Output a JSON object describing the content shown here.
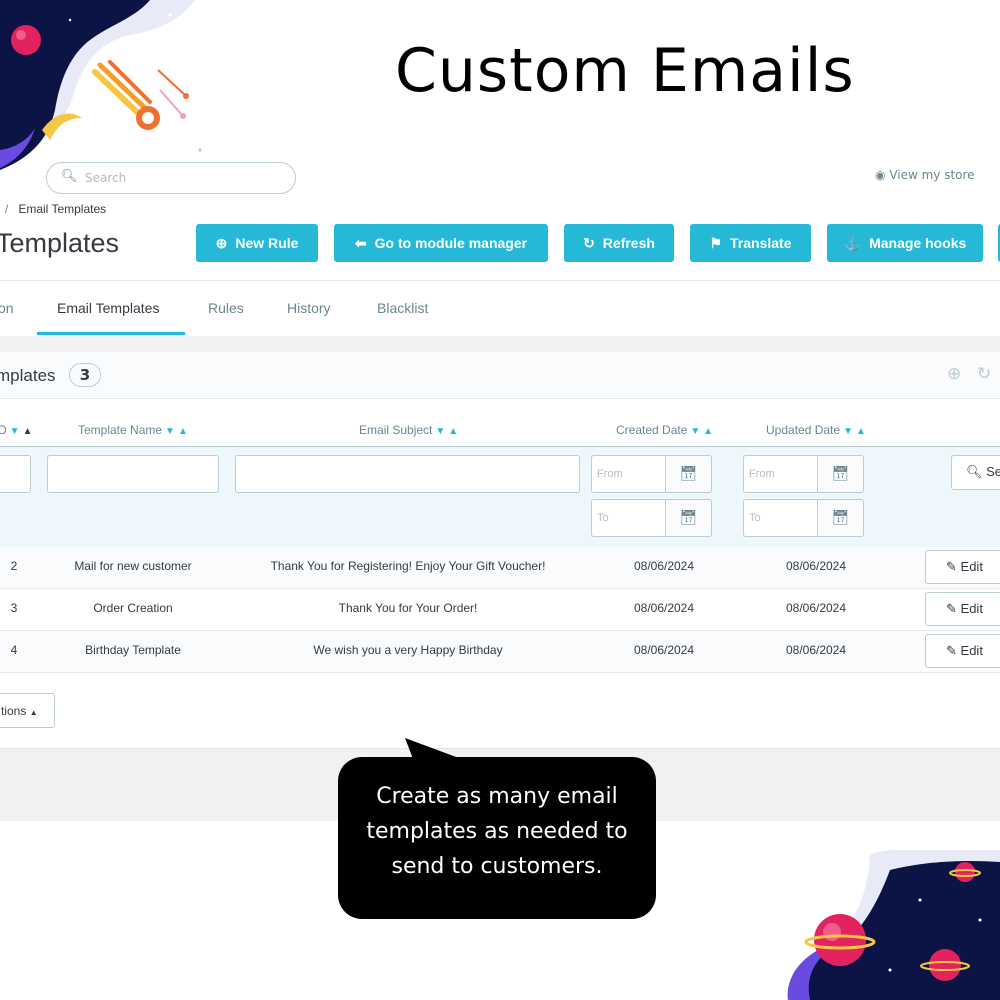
{
  "headline": "Custom Emails",
  "top": {
    "search_placeholder": "Search",
    "view_store": "View my store"
  },
  "breadcrumb": {
    "separator": "/",
    "current": "Email Templates"
  },
  "page_title": "Templates",
  "toolbar": {
    "buttons": [
      {
        "label": "New Rule",
        "icon": "plus-circle-icon"
      },
      {
        "label": "Go to module manager",
        "icon": "arrow-left-circle-icon"
      },
      {
        "label": "Refresh",
        "icon": "refresh-icon"
      },
      {
        "label": "Translate",
        "icon": "flag-icon"
      },
      {
        "label": "Manage hooks",
        "icon": "anchor-icon"
      }
    ]
  },
  "tabs": [
    {
      "label": "on",
      "active": false
    },
    {
      "label": "Email Templates",
      "active": true
    },
    {
      "label": "Rules",
      "active": false
    },
    {
      "label": "History",
      "active": false
    },
    {
      "label": "Blacklist",
      "active": false
    }
  ],
  "panel": {
    "title": "mplates",
    "count": "3"
  },
  "table": {
    "columns": [
      {
        "label": "D"
      },
      {
        "label": "Template Name"
      },
      {
        "label": "Email Subject"
      },
      {
        "label": "Created Date"
      },
      {
        "label": "Updated Date"
      }
    ],
    "filters": {
      "from_placeholder": "From",
      "to_placeholder": "To",
      "search_label": "Sea"
    },
    "rows": [
      {
        "id": "2",
        "name": "Mail for new customer",
        "subject": "Thank You for Registering! Enjoy Your Gift Voucher!",
        "created": "08/06/2024",
        "updated": "08/06/2024",
        "action": "Edit"
      },
      {
        "id": "3",
        "name": "Order Creation",
        "subject": "Thank You for Your Order!",
        "created": "08/06/2024",
        "updated": "08/06/2024",
        "action": "Edit"
      },
      {
        "id": "4",
        "name": "Birthday Template",
        "subject": "We wish you a very Happy Birthday",
        "created": "08/06/2024",
        "updated": "08/06/2024",
        "action": "Edit"
      }
    ],
    "bulk_actions": "tions"
  },
  "callout": {
    "line1": "Create as many email",
    "line2": "templates as needed to",
    "line3": "send to customers."
  },
  "colors": {
    "accent": "#25b9d7",
    "text": "#363a41",
    "muted": "#6c868e",
    "border": "#bbcdd2"
  }
}
